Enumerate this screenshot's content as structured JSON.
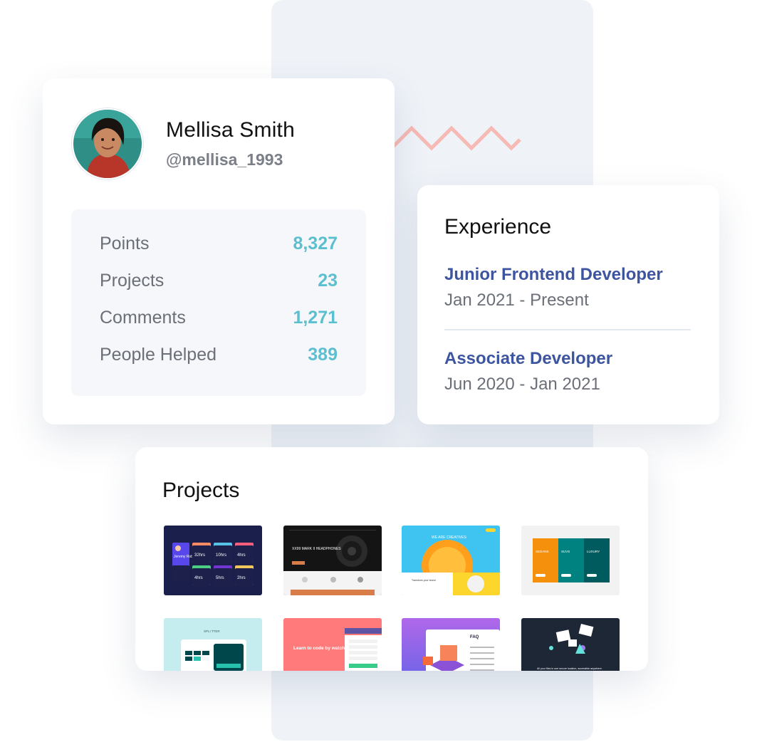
{
  "profile": {
    "name": "Mellisa Smith",
    "handle": "@mellisa_1993",
    "stats": [
      {
        "label": "Points",
        "value": "8,327"
      },
      {
        "label": "Projects",
        "value": "23"
      },
      {
        "label": "Comments",
        "value": "1,271"
      },
      {
        "label": "People Helped",
        "value": "389"
      }
    ]
  },
  "experience": {
    "title": "Experience",
    "jobs": [
      {
        "title": "Junior Frontend Developer",
        "dates": "Jan 2021 - Present"
      },
      {
        "title": "Associate Developer",
        "dates": "Jun 2020 - Jan 2021"
      }
    ]
  },
  "projects": {
    "title": "Projects",
    "thumbnails": [
      {
        "name": "time-tracking-dashboard-thumbnail",
        "bg": "#1b1f4b",
        "thumb_text": [
          "Jeremy Robson",
          "32hrs",
          "10hrs",
          "4hrs",
          "4hrs",
          "5hrs",
          "2hrs"
        ]
      },
      {
        "name": "headphones-landing-thumbnail",
        "bg": "#141414",
        "thumb_text": [
          "XX99 MARK II HEADPHONES"
        ]
      },
      {
        "name": "sunnyside-agency-thumbnail",
        "bg": "#3fc3f0",
        "thumb_text": [
          "WE ARE CREATIVES",
          "Transform your brand"
        ]
      },
      {
        "name": "pricing-columns-thumbnail",
        "bg": "#f2f2f2",
        "thumb_text": [
          "SEDANS",
          "SUVS",
          "LUXURY"
        ]
      },
      {
        "name": "tip-calculator-thumbnail",
        "bg": "#c5ecef",
        "thumb_text": [
          "SPLI TTER"
        ]
      },
      {
        "name": "intro-signup-thumbnail",
        "bg": "#ff7b7b",
        "thumb_text": [
          "Learn to code by watching others"
        ]
      },
      {
        "name": "faq-accordion-thumbnail",
        "bg": "#a86ef0",
        "thumb_text": [
          "FAQ"
        ]
      },
      {
        "name": "fylo-landing-thumbnail",
        "bg": "#1d2736",
        "thumb_text": [
          "All your files in one secure location, accessible anywhere."
        ]
      }
    ]
  },
  "colors": {
    "accent_teal": "#5bbfcf",
    "job_title_blue": "#3d55a0",
    "zigzag_pink": "#f6b9b4",
    "background_column": "#eff3f8"
  }
}
